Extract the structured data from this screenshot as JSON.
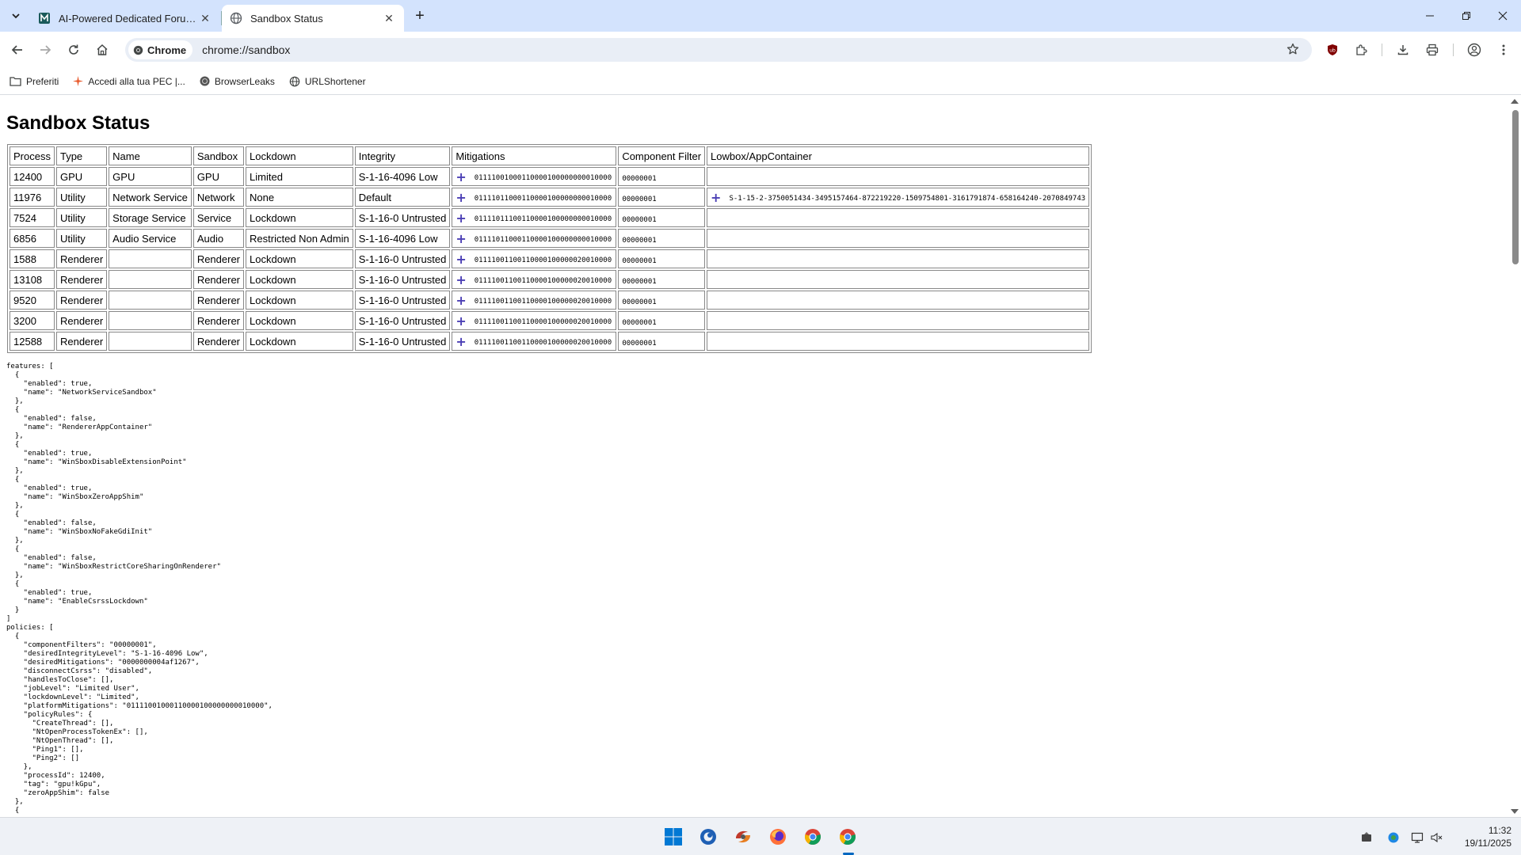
{
  "browser": {
    "tabs": [
      {
        "title": "AI-Powered Dedicated Forum |",
        "active": false
      },
      {
        "title": "Sandbox Status",
        "active": true
      }
    ],
    "chip_label": "Chrome",
    "url": "chrome://sandbox",
    "bookmarks": [
      "Preferiti",
      "Accedi alla tua PEC |...",
      "BrowserLeaks",
      "URLShortener"
    ]
  },
  "page": {
    "title": "Sandbox Status",
    "columns": [
      "Process",
      "Type",
      "Name",
      "Sandbox",
      "Lockdown",
      "Integrity",
      "Mitigations",
      "Component Filter",
      "Lowbox/AppContainer"
    ],
    "rows": [
      {
        "process": "12400",
        "type": "GPU",
        "name": "GPU",
        "sandbox": "GPU",
        "lockdown": "Limited",
        "integrity": "S-1-16-4096 Low",
        "mitigations": "01111001000110000100000000010000",
        "filter": "00000001",
        "lowbox": "",
        "lowbox_plus": false
      },
      {
        "process": "11976",
        "type": "Utility",
        "name": "Network Service",
        "sandbox": "Network",
        "lockdown": "None",
        "integrity": "Default",
        "mitigations": "01111011000110000100000000010000",
        "filter": "00000001",
        "lowbox": "S-1-15-2-3750051434-3495157464-872219220-1509754801-3161791874-658164240-2070849743",
        "lowbox_plus": true
      },
      {
        "process": "7524",
        "type": "Utility",
        "name": "Storage Service",
        "sandbox": "Service",
        "lockdown": "Lockdown",
        "integrity": "S-1-16-0 Untrusted",
        "mitigations": "01111011100110000100000000010000",
        "filter": "00000001",
        "lowbox": "",
        "lowbox_plus": false
      },
      {
        "process": "6856",
        "type": "Utility",
        "name": "Audio Service",
        "sandbox": "Audio",
        "lockdown": "Restricted Non Admin",
        "integrity": "S-1-16-4096 Low",
        "mitigations": "01111011000110000100000000010000",
        "filter": "00000001",
        "lowbox": "",
        "lowbox_plus": false
      },
      {
        "process": "1588",
        "type": "Renderer",
        "name": "",
        "sandbox": "Renderer",
        "lockdown": "Lockdown",
        "integrity": "S-1-16-0 Untrusted",
        "mitigations": "01111001100110000100000020010000",
        "filter": "00000001",
        "lowbox": "",
        "lowbox_plus": false
      },
      {
        "process": "13108",
        "type": "Renderer",
        "name": "",
        "sandbox": "Renderer",
        "lockdown": "Lockdown",
        "integrity": "S-1-16-0 Untrusted",
        "mitigations": "01111001100110000100000020010000",
        "filter": "00000001",
        "lowbox": "",
        "lowbox_plus": false
      },
      {
        "process": "9520",
        "type": "Renderer",
        "name": "",
        "sandbox": "Renderer",
        "lockdown": "Lockdown",
        "integrity": "S-1-16-0 Untrusted",
        "mitigations": "01111001100110000100000020010000",
        "filter": "00000001",
        "lowbox": "",
        "lowbox_plus": false
      },
      {
        "process": "3200",
        "type": "Renderer",
        "name": "",
        "sandbox": "Renderer",
        "lockdown": "Lockdown",
        "integrity": "S-1-16-0 Untrusted",
        "mitigations": "01111001100110000100000020010000",
        "filter": "00000001",
        "lowbox": "",
        "lowbox_plus": false
      },
      {
        "process": "12588",
        "type": "Renderer",
        "name": "",
        "sandbox": "Renderer",
        "lockdown": "Lockdown",
        "integrity": "S-1-16-0 Untrusted",
        "mitigations": "01111001100110000100000020010000",
        "filter": "00000001",
        "lowbox": "",
        "lowbox_plus": false
      }
    ],
    "json_dump": "features: [\n  {\n    \"enabled\": true,\n    \"name\": \"NetworkServiceSandbox\"\n  },\n  {\n    \"enabled\": false,\n    \"name\": \"RendererAppContainer\"\n  },\n  {\n    \"enabled\": true,\n    \"name\": \"WinSboxDisableExtensionPoint\"\n  },\n  {\n    \"enabled\": true,\n    \"name\": \"WinSboxZeroAppShim\"\n  },\n  {\n    \"enabled\": false,\n    \"name\": \"WinSboxNoFakeGdiInit\"\n  },\n  {\n    \"enabled\": false,\n    \"name\": \"WinSboxRestrictCoreSharingOnRenderer\"\n  },\n  {\n    \"enabled\": true,\n    \"name\": \"EnableCsrssLockdown\"\n  }\n]\npolicies: [\n  {\n    \"componentFilters\": \"00000001\",\n    \"desiredIntegrityLevel\": \"S-1-16-4096 Low\",\n    \"desiredMitigations\": \"0000000004af1267\",\n    \"disconnectCsrss\": \"disabled\",\n    \"handlesToClose\": [],\n    \"jobLevel\": \"Limited User\",\n    \"lockdownLevel\": \"Limited\",\n    \"platformMitigations\": \"01111001000110000100000000010000\",\n    \"policyRules\": {\n      \"CreateThread\": [],\n      \"NtOpenProcessTokenEx\": [],\n      \"NtOpenThread\": [],\n      \"Ping1\": [],\n      \"Ping2\": []\n    },\n    \"processId\": 12400,\n    \"tag\": \"gpu!kGpu\",\n    \"zeroAppShim\": false\n  },\n  {"
  },
  "taskbar": {
    "time": "11:32",
    "date": "19/11/2025"
  },
  "icons": {
    "tab_search": "chevron-down-icon",
    "back": "back-arrow-icon",
    "forward": "forward-arrow-icon",
    "reload": "reload-icon",
    "home": "home-icon",
    "bookmark_star": "star-icon",
    "extensions": "puzzle-icon",
    "download": "download-icon",
    "print": "print-icon",
    "profile": "profile-icon",
    "menu": "kebab-menu-icon"
  },
  "colors": {
    "tabstrip": "#d3e3fd",
    "omnibox": "#e9eef6",
    "plus": "#4b3fb5",
    "accent": "#0067c0"
  }
}
